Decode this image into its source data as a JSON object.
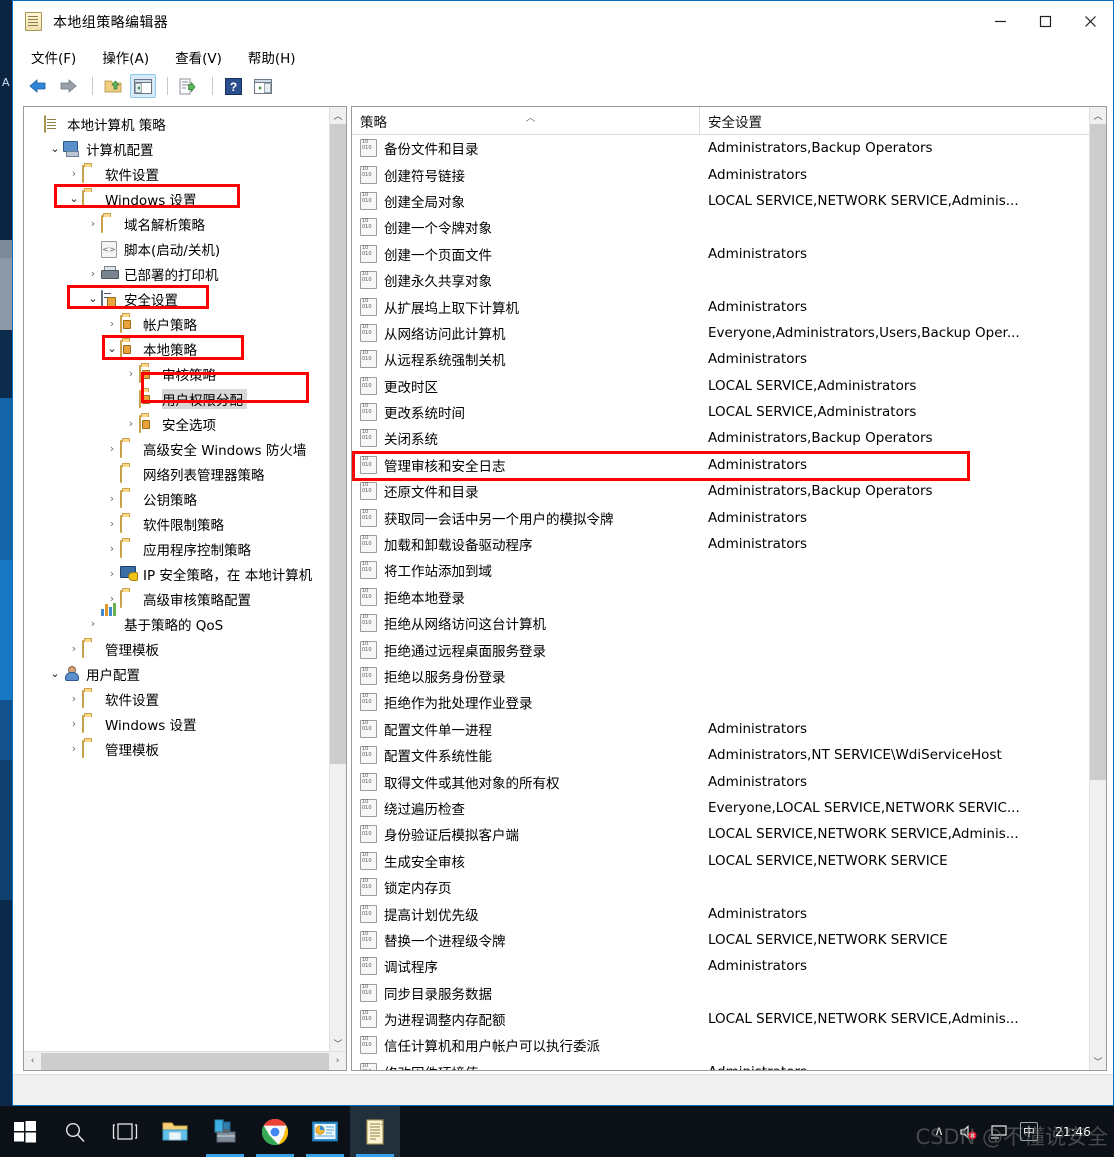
{
  "window": {
    "title": "本地组策略编辑器",
    "title_icon": "scroll-document-icon",
    "controls": {
      "minimize": "—",
      "maximize": "□",
      "close": "✕"
    }
  },
  "menu": {
    "items": [
      {
        "label": "文件(F)",
        "name": "menu-file"
      },
      {
        "label": "操作(A)",
        "name": "menu-action"
      },
      {
        "label": "查看(V)",
        "name": "menu-view"
      },
      {
        "label": "帮助(H)",
        "name": "menu-help"
      }
    ]
  },
  "toolbar": {
    "buttons": [
      {
        "name": "back-icon",
        "glyph": "⬅"
      },
      {
        "name": "forward-icon",
        "glyph": "➡"
      },
      {
        "name": "up-folder-icon",
        "glyph": "folder-up"
      },
      {
        "name": "show-hide-tree-icon",
        "glyph": "tree-pane"
      },
      {
        "name": "export-list-icon",
        "glyph": "export"
      },
      {
        "name": "help-icon",
        "glyph": "?"
      },
      {
        "name": "show-details-icon",
        "glyph": "details-pane"
      }
    ]
  },
  "desktop": {
    "letter": "A"
  },
  "tree": {
    "nodes": [
      {
        "label": "本地计算机 策略",
        "indent": 0,
        "chev": "",
        "icon": "scroll-document-icon",
        "name": "tree-local-computer-policy"
      },
      {
        "label": "计算机配置",
        "indent": 1,
        "chev": "open",
        "icon": "computer-icon",
        "name": "tree-computer-configuration"
      },
      {
        "label": "软件设置",
        "indent": 2,
        "chev": "closed",
        "icon": "folder-icon",
        "name": "tree-software-settings"
      },
      {
        "label": "Windows 设置",
        "indent": 2,
        "chev": "open",
        "icon": "folder-icon",
        "name": "tree-windows-settings",
        "highlight": true
      },
      {
        "label": "域名解析策略",
        "indent": 3,
        "chev": "closed",
        "icon": "folder-icon",
        "name": "tree-name-resolution-policy"
      },
      {
        "label": "脚本(启动/关机)",
        "indent": 3,
        "chev": "",
        "icon": "script-icon",
        "name": "tree-scripts"
      },
      {
        "label": "已部署的打印机",
        "indent": 3,
        "chev": "closed",
        "icon": "printer-icon",
        "name": "tree-deployed-printers"
      },
      {
        "label": "安全设置",
        "indent": 3,
        "chev": "open",
        "icon": "server-lock-icon",
        "name": "tree-security-settings",
        "highlight": true
      },
      {
        "label": "帐户策略",
        "indent": 4,
        "chev": "closed",
        "icon": "folder-lock-icon",
        "name": "tree-account-policies"
      },
      {
        "label": "本地策略",
        "indent": 4,
        "chev": "open",
        "icon": "folder-lock-icon",
        "name": "tree-local-policies",
        "highlight": true
      },
      {
        "label": "审核策略",
        "indent": 5,
        "chev": "closed",
        "icon": "folder-lock-icon",
        "name": "tree-audit-policy"
      },
      {
        "label": "用户权限分配",
        "indent": 5,
        "chev": "",
        "icon": "folder-lock-icon",
        "name": "tree-user-rights-assignment",
        "selected": true,
        "highlight": true
      },
      {
        "label": "安全选项",
        "indent": 5,
        "chev": "closed",
        "icon": "folder-lock-icon",
        "name": "tree-security-options"
      },
      {
        "label": "高级安全 Windows 防火墙",
        "indent": 4,
        "chev": "closed",
        "icon": "folder-icon",
        "name": "tree-windows-firewall"
      },
      {
        "label": "网络列表管理器策略",
        "indent": 4,
        "chev": "",
        "icon": "folder-icon",
        "name": "tree-network-list-manager"
      },
      {
        "label": "公钥策略",
        "indent": 4,
        "chev": "closed",
        "icon": "folder-icon",
        "name": "tree-public-key-policies"
      },
      {
        "label": "软件限制策略",
        "indent": 4,
        "chev": "closed",
        "icon": "folder-icon",
        "name": "tree-software-restriction-policies"
      },
      {
        "label": "应用程序控制策略",
        "indent": 4,
        "chev": "closed",
        "icon": "folder-icon",
        "name": "tree-application-control-policies"
      },
      {
        "label": "IP 安全策略，在 本地计算机",
        "indent": 4,
        "chev": "closed",
        "icon": "ipsec-icon",
        "name": "tree-ip-security-policies"
      },
      {
        "label": "高级审核策略配置",
        "indent": 4,
        "chev": "closed",
        "icon": "folder-icon",
        "name": "tree-advanced-audit-policy"
      },
      {
        "label": "基于策略的 QoS",
        "indent": 3,
        "chev": "closed",
        "icon": "qos-icon",
        "name": "tree-policy-based-qos"
      },
      {
        "label": "管理模板",
        "indent": 2,
        "chev": "closed",
        "icon": "folder-icon",
        "name": "tree-admin-templates-computer"
      },
      {
        "label": "用户配置",
        "indent": 1,
        "chev": "open",
        "icon": "user-icon",
        "name": "tree-user-configuration"
      },
      {
        "label": "软件设置",
        "indent": 2,
        "chev": "closed",
        "icon": "folder-icon",
        "name": "tree-user-software-settings"
      },
      {
        "label": "Windows 设置",
        "indent": 2,
        "chev": "closed",
        "icon": "folder-icon",
        "name": "tree-user-windows-settings"
      },
      {
        "label": "管理模板",
        "indent": 2,
        "chev": "closed",
        "icon": "folder-icon",
        "name": "tree-admin-templates-user"
      }
    ],
    "hscroll": {
      "left_glyph": "‹",
      "right_glyph": "›"
    }
  },
  "list": {
    "columns": [
      {
        "label": "策略",
        "name": "column-policy"
      },
      {
        "label": "安全设置",
        "name": "column-security-setting"
      }
    ],
    "sort_indicator": "︿",
    "rows": [
      {
        "policy": "备份文件和目录",
        "setting": "Administrators,Backup Operators"
      },
      {
        "policy": "创建符号链接",
        "setting": "Administrators"
      },
      {
        "policy": "创建全局对象",
        "setting": "LOCAL SERVICE,NETWORK SERVICE,Adminis..."
      },
      {
        "policy": "创建一个令牌对象",
        "setting": ""
      },
      {
        "policy": "创建一个页面文件",
        "setting": "Administrators"
      },
      {
        "policy": "创建永久共享对象",
        "setting": ""
      },
      {
        "policy": "从扩展坞上取下计算机",
        "setting": "Administrators"
      },
      {
        "policy": "从网络访问此计算机",
        "setting": "Everyone,Administrators,Users,Backup Oper..."
      },
      {
        "policy": "从远程系统强制关机",
        "setting": "Administrators"
      },
      {
        "policy": "更改时区",
        "setting": "LOCAL SERVICE,Administrators"
      },
      {
        "policy": "更改系统时间",
        "setting": "LOCAL SERVICE,Administrators"
      },
      {
        "policy": "关闭系统",
        "setting": "Administrators,Backup Operators"
      },
      {
        "policy": "管理审核和安全日志",
        "setting": "Administrators",
        "highlight": true
      },
      {
        "policy": "还原文件和目录",
        "setting": "Administrators,Backup Operators"
      },
      {
        "policy": "获取同一会话中另一个用户的模拟令牌",
        "setting": "Administrators"
      },
      {
        "policy": "加载和卸载设备驱动程序",
        "setting": "Administrators"
      },
      {
        "policy": "将工作站添加到域",
        "setting": ""
      },
      {
        "policy": "拒绝本地登录",
        "setting": ""
      },
      {
        "policy": "拒绝从网络访问这台计算机",
        "setting": ""
      },
      {
        "policy": "拒绝通过远程桌面服务登录",
        "setting": ""
      },
      {
        "policy": "拒绝以服务身份登录",
        "setting": ""
      },
      {
        "policy": "拒绝作为批处理作业登录",
        "setting": ""
      },
      {
        "policy": "配置文件单一进程",
        "setting": "Administrators"
      },
      {
        "policy": "配置文件系统性能",
        "setting": "Administrators,NT SERVICE\\WdiServiceHost"
      },
      {
        "policy": "取得文件或其他对象的所有权",
        "setting": "Administrators"
      },
      {
        "policy": "绕过遍历检查",
        "setting": "Everyone,LOCAL SERVICE,NETWORK SERVIC..."
      },
      {
        "policy": "身份验证后模拟客户端",
        "setting": "LOCAL SERVICE,NETWORK SERVICE,Adminis..."
      },
      {
        "policy": "生成安全审核",
        "setting": "LOCAL SERVICE,NETWORK SERVICE"
      },
      {
        "policy": "锁定内存页",
        "setting": ""
      },
      {
        "policy": "提高计划优先级",
        "setting": "Administrators"
      },
      {
        "policy": "替换一个进程级令牌",
        "setting": "LOCAL SERVICE,NETWORK SERVICE"
      },
      {
        "policy": "调试程序",
        "setting": "Administrators"
      },
      {
        "policy": "同步目录服务数据",
        "setting": ""
      },
      {
        "policy": "为进程调整内存配额",
        "setting": "LOCAL SERVICE,NETWORK SERVICE,Adminis..."
      },
      {
        "policy": "信任计算机和用户帐户可以执行委派",
        "setting": ""
      },
      {
        "policy": "修改固件环境值",
        "setting": "Administrators"
      }
    ],
    "scroll": {
      "up_glyph": "︿",
      "down_glyph": "﹀"
    }
  },
  "taskbar": {
    "items": [
      {
        "name": "start-button",
        "glyph": "windows-logo-icon"
      },
      {
        "name": "search-button",
        "glyph": "search-icon"
      },
      {
        "name": "task-view-button",
        "glyph": "task-view-icon"
      },
      {
        "name": "file-explorer-button",
        "glyph": "folder-icon"
      },
      {
        "name": "app-toolbox-button",
        "glyph": "toolbox-icon",
        "running": true
      },
      {
        "name": "chrome-button",
        "glyph": "chrome-icon",
        "running": true
      },
      {
        "name": "presentation-button",
        "glyph": "slides-icon",
        "running": true
      },
      {
        "name": "gpedit-button",
        "glyph": "scroll-document-icon",
        "active": true
      }
    ],
    "tray": {
      "chevron": "∧",
      "volume": "speaker-muted-icon",
      "network": "monitor-icon",
      "ime": "中",
      "time": "21:46"
    }
  },
  "watermark": {
    "text": "CSDN @不懂说安全"
  },
  "colors": {
    "accent": "#0a6ebd",
    "annotation_red": "#ff0000",
    "selection_gray": "#d8d8d8",
    "taskbar_bg": "#0b1117"
  }
}
